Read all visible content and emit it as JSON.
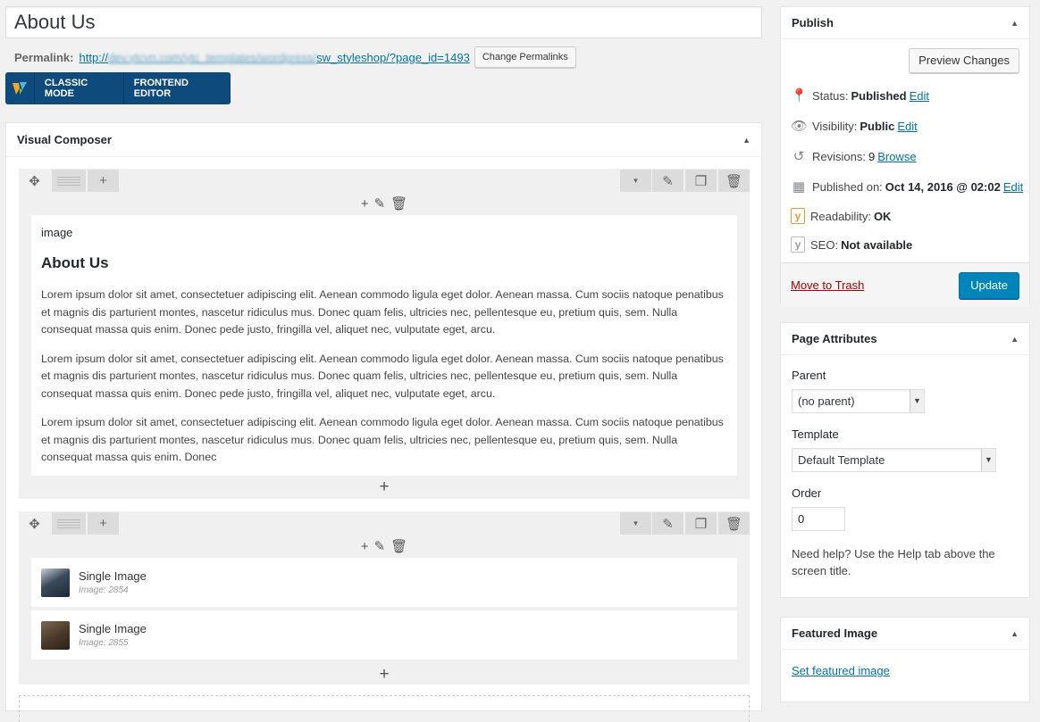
{
  "post": {
    "title": "About Us",
    "permalink_label": "Permalink:",
    "permalink_prefix": "http://",
    "permalink_blurred": "dev.ytcvn.com/ytc_templates/wordpress/",
    "permalink_suffix": "sw_styleshop/?page_id=1493",
    "change_permalinks": "Change Permalinks"
  },
  "vc_bar": {
    "logo_icon": "visual-composer-logo-icon",
    "classic_mode": "CLASSIC MODE",
    "frontend_editor": "FRONTEND EDITOR"
  },
  "vc_panel": {
    "title": "Visual Composer",
    "row1": {
      "label": "image",
      "heading": "About Us",
      "paragraphs": [
        "Lorem ipsum dolor sit amet, consectetuer adipiscing elit. Aenean commodo ligula eget dolor. Aenean massa. Cum sociis natoque penatibus et magnis dis parturient montes, nascetur ridiculus mus. Donec quam felis, ultricies nec, pellentesque eu, pretium quis, sem. Nulla consequat massa quis enim. Donec pede justo, fringilla vel, aliquet nec, vulputate eget, arcu.",
        "Lorem ipsum dolor sit amet, consectetuer adipiscing elit. Aenean commodo ligula eget dolor. Aenean massa. Cum sociis natoque penatibus et magnis dis parturient montes, nascetur ridiculus mus. Donec quam felis, ultricies nec, pellentesque eu, pretium quis, sem. Nulla consequat massa quis enim. Donec pede justo, fringilla vel, aliquet nec, vulputate eget, arcu.",
        "Lorem ipsum dolor sit amet, consectetuer adipiscing elit. Aenean commodo ligula eget dolor. Aenean massa. Cum sociis natoque penatibus et magnis dis parturient montes, nascetur ridiculus mus. Donec quam felis, ultricies nec, pellentesque eu, pretium quis, sem. Nulla consequat massa quis enim. Donec"
      ]
    },
    "row2": {
      "items": [
        {
          "title": "Single Image",
          "sub": "Image: 2854"
        },
        {
          "title": "Single Image",
          "sub": "Image: 2855"
        }
      ]
    }
  },
  "publish": {
    "title": "Publish",
    "preview": "Preview Changes",
    "status_label": "Status:",
    "status_value": "Published",
    "status_edit": "Edit",
    "visibility_label": "Visibility:",
    "visibility_value": "Public",
    "visibility_edit": "Edit",
    "revisions_label": "Revisions:",
    "revisions_value": "9",
    "revisions_browse": "Browse",
    "published_label": "Published on:",
    "published_value": "Oct 14, 2016 @ 02:02",
    "published_edit": "Edit",
    "readability_label": "Readability:",
    "readability_value": "OK",
    "seo_label": "SEO:",
    "seo_value": "Not available",
    "trash": "Move to Trash",
    "update": "Update"
  },
  "page_attributes": {
    "title": "Page Attributes",
    "parent_label": "Parent",
    "parent_value": "(no parent)",
    "template_label": "Template",
    "template_value": "Default Template",
    "order_label": "Order",
    "order_value": "0",
    "help": "Need help? Use the Help tab above the screen title."
  },
  "featured_image": {
    "title": "Featured Image",
    "link": "Set featured image"
  },
  "colors": {
    "vc_blue": "#0e4a7b",
    "update_blue": "#0085ba",
    "trash_red": "#aa0000",
    "yoast_orange": "#e69b2e"
  }
}
